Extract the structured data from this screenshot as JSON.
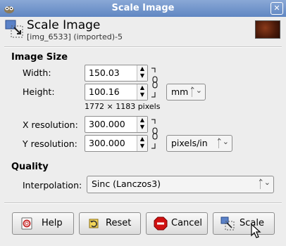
{
  "window": {
    "title": "Scale Image"
  },
  "header": {
    "title": "Scale Image",
    "subtitle": "[img_6533] (imported)-5"
  },
  "image_size": {
    "section_label": "Image Size",
    "width_label": "Width:",
    "width_value": "150.03",
    "height_label": "Height:",
    "height_value": "100.16",
    "unit": "mm",
    "pixel_dims": "1772 × 1183 pixels",
    "xres_label": "X resolution:",
    "xres_value": "300.000",
    "yres_label": "Y resolution:",
    "yres_value": "300.000",
    "res_unit": "pixels/in"
  },
  "quality": {
    "section_label": "Quality",
    "interp_label": "Interpolation:",
    "interp_value": "Sinc (Lanczos3)"
  },
  "buttons": {
    "help": "Help",
    "reset": "Reset",
    "cancel": "Cancel",
    "scale": "Scale"
  },
  "icons": [
    "gimp-icon",
    "close-icon",
    "scale-icon",
    "image-thumbnail",
    "chain-link-icon",
    "help-icon",
    "reset-icon",
    "cancel-icon",
    "mouse-cursor-icon"
  ]
}
